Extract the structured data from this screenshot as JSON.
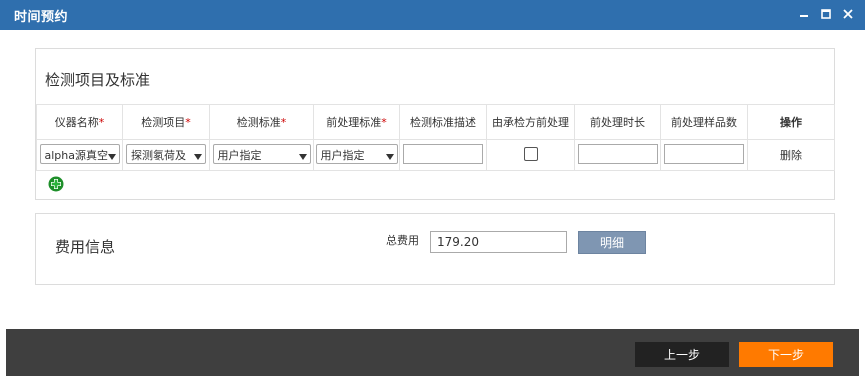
{
  "window": {
    "title": "时间预约",
    "controls": [
      "minimize-icon",
      "maximize-icon",
      "close-icon"
    ]
  },
  "section_items": {
    "title": "检测项目及标准",
    "columns": [
      {
        "label": "仪器名称",
        "required": true
      },
      {
        "label": "检测项目",
        "required": true
      },
      {
        "label": "检测标准",
        "required": true
      },
      {
        "label": "前处理标准",
        "required": true
      },
      {
        "label": "检测标准描述",
        "required": false
      },
      {
        "label": "由承检方前处理",
        "required": false
      },
      {
        "label": "前处理时长",
        "required": false
      },
      {
        "label": "前处理样品数",
        "required": false
      },
      {
        "label": "操作",
        "required": false
      }
    ],
    "row": {
      "instrument": "alpha源真空",
      "item": "探测氡荷及",
      "standard": "用户指定",
      "pretreat_standard": "用户指定",
      "desc": "",
      "by_inspector": false,
      "duration": "",
      "sample_count": "",
      "delete_label": "删除"
    },
    "add_icon": "add-icon"
  },
  "section_fee": {
    "title": "费用信息",
    "total_label": "总费用",
    "total_value": "179.20",
    "detail_button": "明细"
  },
  "footer": {
    "prev_label": "上一步",
    "next_label": "下一步"
  },
  "colors": {
    "titlebar": "#2f6fae",
    "detail_button": "#7f96b2",
    "prev_button": "#222222",
    "next_button": "#ff7a00",
    "footer": "#3f3f3f"
  }
}
